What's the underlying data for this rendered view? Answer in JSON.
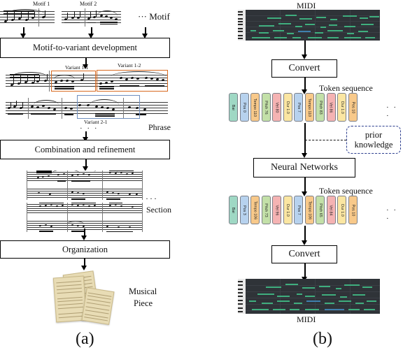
{
  "figure": {
    "panels": [
      {
        "id": "a",
        "letter": "(a)"
      },
      {
        "id": "b",
        "letter": "(b)"
      }
    ]
  },
  "panel_a": {
    "motif_labels": [
      "Motif 1",
      "Motif 2"
    ],
    "motif_level": "···  Motif",
    "stage1_box": "Motif-to-variant development",
    "variant_labels": [
      "Variant 1-1",
      "Variant 1-2",
      "Variant 2-1"
    ],
    "phrase_level": "Phrase",
    "ellipsis_mid": "· · ·",
    "stage2_box": "Combination and refinement",
    "section_ellipsis": "···",
    "section_level": "Section",
    "stage3_box": "Organization",
    "output_label_line1": "Musical",
    "output_label_line2": "Piece",
    "highlight_color": "#d8691f",
    "highlight_color_alt": "#6f8fbf"
  },
  "panel_b": {
    "midi_top_label": "MIDI",
    "convert_box_top": "Convert",
    "token_sequence_label_top": "Token sequence",
    "tokens_top": [
      {
        "text": "Bar",
        "color": "#9fd8c4"
      },
      {
        "text": "Pos 0",
        "color": "#b7d2ee"
      },
      {
        "text": "Tempo 110",
        "color": "#f8c98a"
      },
      {
        "text": "Pitch 76",
        "color": "#c3e0a8"
      },
      {
        "text": "Vel 80",
        "color": "#f5b3b3"
      },
      {
        "text": "Dur 1.0",
        "color": "#fbe6a2"
      },
      {
        "text": "Pos 7",
        "color": "#b7d2ee"
      },
      {
        "text": "Tempo 110",
        "color": "#f8c98a"
      },
      {
        "text": "Pitch 83",
        "color": "#c3e0a8"
      },
      {
        "text": "Vel 86",
        "color": "#f5b3b3"
      },
      {
        "text": "Dur 1.0",
        "color": "#fbe6a2"
      },
      {
        "text": "Pos 10",
        "color": "#f8c98a"
      }
    ],
    "tokens_top_ellipsis": "· · ·",
    "prior_knowledge_line1": "prior",
    "prior_knowledge_line2": "knowledge",
    "neural_networks_box": "Neural Networks",
    "token_sequence_label_bottom": "Token sequence",
    "tokens_bottom": [
      {
        "text": "Bar",
        "color": "#9fd8c4"
      },
      {
        "text": "Pos 3",
        "color": "#b7d2ee"
      },
      {
        "text": "Tempo 106",
        "color": "#f8c98a"
      },
      {
        "text": "Pitch 73",
        "color": "#c3e0a8"
      },
      {
        "text": "Vel 96",
        "color": "#f5b3b3"
      },
      {
        "text": "Dur 1.0",
        "color": "#fbe6a2"
      },
      {
        "text": "Pos 7",
        "color": "#b7d2ee"
      },
      {
        "text": "Tempo 106",
        "color": "#f8c98a"
      },
      {
        "text": "Pitch 65",
        "color": "#c3e0a8"
      },
      {
        "text": "Vel 84",
        "color": "#f5b3b3"
      },
      {
        "text": "Dur 1.0",
        "color": "#fbe6a2"
      },
      {
        "text": "Pos 10",
        "color": "#f8c98a"
      }
    ],
    "tokens_bottom_ellipsis": "· · ·",
    "convert_box_bottom": "Convert",
    "midi_bottom_label": "MIDI",
    "prior_knowledge_border": "#2d3f8f"
  }
}
